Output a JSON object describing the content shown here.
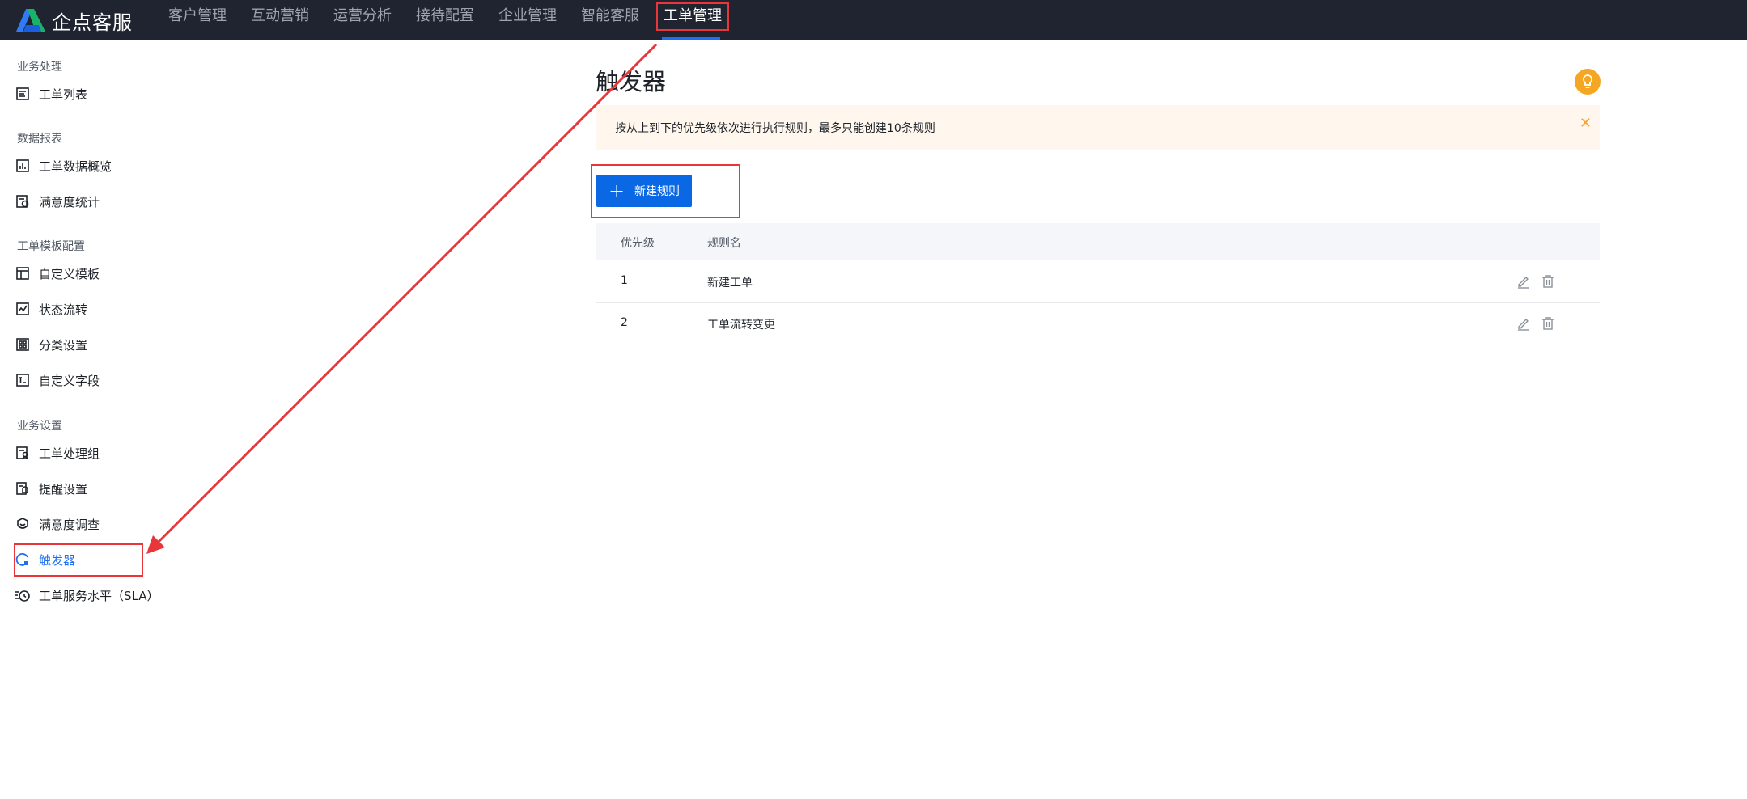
{
  "header": {
    "brand": "企点客服",
    "nav": [
      "客户管理",
      "互动营销",
      "运营分析",
      "接待配置",
      "企业管理",
      "智能客服",
      "工单管理"
    ],
    "active_nav": "工单管理"
  },
  "sidebar": {
    "groups": [
      {
        "title": "业务处理",
        "items": [
          {
            "label": "工单列表",
            "icon": "ticket-list-icon"
          }
        ]
      },
      {
        "title": "数据报表",
        "items": [
          {
            "label": "工单数据概览",
            "icon": "chart-icon"
          },
          {
            "label": "满意度统计",
            "icon": "satisfaction-stats-icon"
          }
        ]
      },
      {
        "title": "工单模板配置",
        "items": [
          {
            "label": "自定义模板",
            "icon": "template-icon"
          },
          {
            "label": "状态流转",
            "icon": "flow-icon"
          },
          {
            "label": "分类设置",
            "icon": "category-icon"
          },
          {
            "label": "自定义字段",
            "icon": "field-icon"
          }
        ]
      },
      {
        "title": "业务设置",
        "items": [
          {
            "label": "工单处理组",
            "icon": "group-icon"
          },
          {
            "label": "提醒设置",
            "icon": "reminder-icon"
          },
          {
            "label": "满意度调查",
            "icon": "survey-icon"
          },
          {
            "label": "触发器",
            "icon": "trigger-icon"
          },
          {
            "label": "工单服务水平（SLA）",
            "icon": "sla-clock-icon"
          }
        ]
      }
    ],
    "active_item": "触发器"
  },
  "main": {
    "title": "触发器",
    "notice": "按从上到下的优先级依次进行执行规则，最多只能创建10条规则",
    "new_button": "新建规则",
    "table": {
      "columns": [
        "优先级",
        "规则名"
      ],
      "rows": [
        {
          "priority": "1",
          "name": "新建工单"
        },
        {
          "priority": "2",
          "name": "工单流转变更"
        }
      ]
    }
  },
  "colors": {
    "topbar": "#1f2430",
    "accent": "#1e6ff1",
    "button": "#0b68e5",
    "notice_bg": "#fff7ed",
    "annotation": "#e8363a"
  }
}
